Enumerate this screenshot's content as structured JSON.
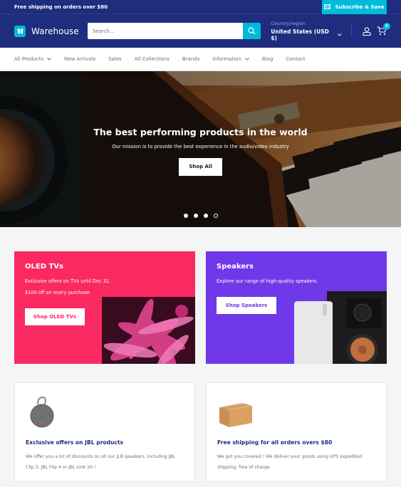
{
  "announcement": {
    "text": "Free shipping on orders over $80",
    "subscribe_label": "Subscribe & Save"
  },
  "header": {
    "logo_text": "Warehouse",
    "search_placeholder": "Search...",
    "country_label": "Country/region",
    "country_value": "United States (USD $)",
    "cart_count": "0"
  },
  "nav": {
    "items": [
      {
        "label": "All Products",
        "dropdown": true
      },
      {
        "label": "New Arrivals",
        "dropdown": false
      },
      {
        "label": "Sales",
        "dropdown": false
      },
      {
        "label": "All Collections",
        "dropdown": false
      },
      {
        "label": "Brands",
        "dropdown": false
      },
      {
        "label": "Information",
        "dropdown": true
      },
      {
        "label": "Blog",
        "dropdown": false
      },
      {
        "label": "Contact",
        "dropdown": false
      }
    ]
  },
  "hero": {
    "title": "The best performing products in the world",
    "subtitle": "Our mission is to provide the best experience in the audio/video industry",
    "button_label": "Shop All",
    "slide_count": 4,
    "active_slide": 4
  },
  "promos": [
    {
      "title": "OLED TVs",
      "lines": [
        "Exclusive offers on TVs until Dec 31.",
        "$100 off on every purchase"
      ],
      "button_label": "Shop OLED TVs",
      "color": "#fb2961"
    },
    {
      "title": "Speakers",
      "lines": [
        "Explore our range of high-quality speakers."
      ],
      "button_label": "Shop Speakers",
      "color": "#6f38e9"
    }
  ],
  "cards": [
    {
      "title": "Exclusive offers on JBL products",
      "text": "We offer you a lot of discounts on all our JLB speakers, including JBL Clip 3, JBL Flip 4 or JBL Link 20 !",
      "image": "jbl-speaker"
    },
    {
      "title": "Free shipping for all orders overs $80",
      "text": "We got you covered ! We deliver your goods using UPS expedited shipping, free of charge",
      "image": "cardboard-box"
    }
  ],
  "colors": {
    "primary": "#1e2d7d",
    "accent": "#00badb",
    "oled": "#fb2961",
    "speakers": "#6f38e9"
  }
}
